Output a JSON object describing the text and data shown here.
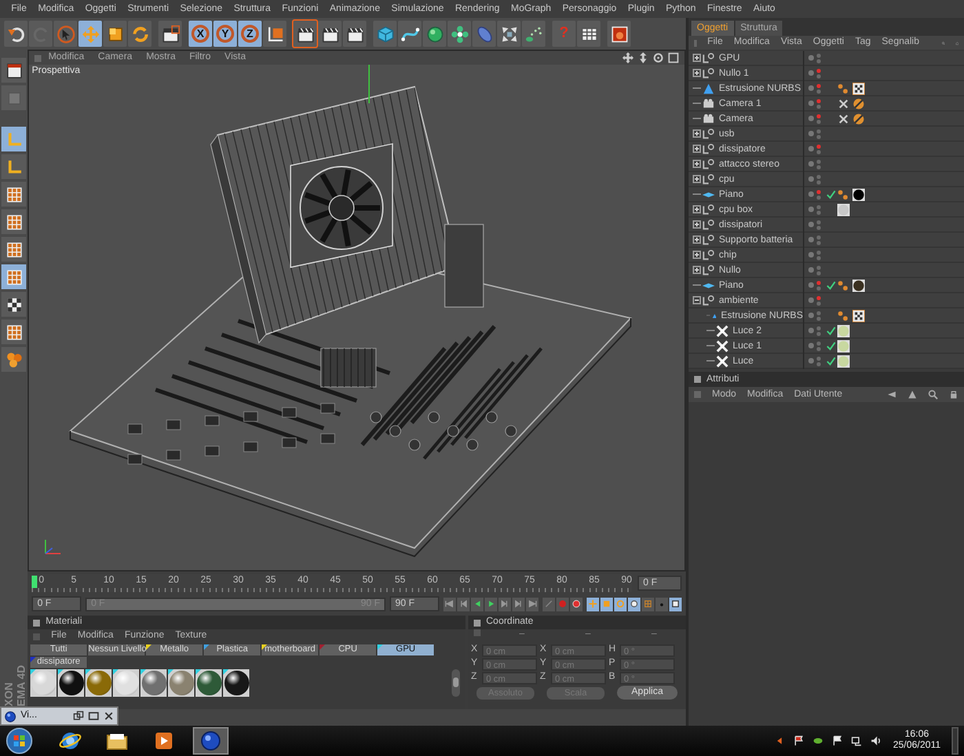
{
  "menu": [
    "File",
    "Modifica",
    "Oggetti",
    "Strumenti",
    "Selezione",
    "Struttura",
    "Funzioni",
    "Animazione",
    "Simulazione",
    "Rendering",
    "MoGraph",
    "Personaggio",
    "Plugin",
    "Python",
    "Finestre",
    "Aiuto"
  ],
  "toolbar": [
    {
      "kind": "undo",
      "selected": false,
      "disabled": false
    },
    {
      "kind": "redo",
      "selected": false,
      "disabled": true
    },
    {
      "kind": "select",
      "selected": false,
      "disabled": false
    },
    {
      "kind": "move",
      "selected": true,
      "disabled": false
    },
    {
      "kind": "scale",
      "selected": false,
      "disabled": false
    },
    {
      "kind": "rotate",
      "selected": false,
      "disabled": false
    },
    {
      "kind": "sep"
    },
    {
      "kind": "recent",
      "selected": false,
      "disabled": false
    },
    {
      "kind": "sep"
    },
    {
      "kind": "axis",
      "label": "X",
      "selected": true,
      "disabled": false
    },
    {
      "kind": "axis",
      "label": "Y",
      "selected": true,
      "disabled": false
    },
    {
      "kind": "axis",
      "label": "Z",
      "selected": true,
      "disabled": false
    },
    {
      "kind": "coord",
      "selected": false,
      "disabled": false
    },
    {
      "kind": "sep"
    },
    {
      "kind": "render-view",
      "selected": false,
      "disabled": false
    },
    {
      "kind": "render-picture",
      "selected": false,
      "disabled": false
    },
    {
      "kind": "render-settings",
      "selected": false,
      "disabled": false
    },
    {
      "kind": "sep"
    },
    {
      "kind": "cube",
      "selected": false,
      "disabled": false
    },
    {
      "kind": "spline",
      "selected": false,
      "disabled": false
    },
    {
      "kind": "nurbs",
      "selected": false,
      "disabled": false
    },
    {
      "kind": "array",
      "selected": false,
      "disabled": false
    },
    {
      "kind": "deformer",
      "selected": false,
      "disabled": false
    },
    {
      "kind": "scene",
      "selected": false,
      "disabled": false
    },
    {
      "kind": "particles",
      "selected": false,
      "disabled": false
    },
    {
      "kind": "sep"
    },
    {
      "kind": "help",
      "label": "?",
      "selected": false,
      "disabled": false
    },
    {
      "kind": "layers",
      "selected": false,
      "disabled": false
    },
    {
      "kind": "sep"
    },
    {
      "kind": "cinema",
      "selected": false,
      "disabled": false
    }
  ],
  "left_tools": [
    {
      "kind": "layout",
      "selected": false
    },
    {
      "kind": "editable",
      "selected": false
    },
    {
      "kind": "corner",
      "selected": true
    },
    {
      "kind": "corner",
      "selected": false
    },
    {
      "kind": "grid",
      "selected": false
    },
    {
      "kind": "grid",
      "selected": false
    },
    {
      "kind": "grid",
      "selected": false
    },
    {
      "kind": "grid",
      "selected": true
    },
    {
      "kind": "checker",
      "selected": false
    },
    {
      "kind": "grid",
      "selected": false
    },
    {
      "kind": "spheres",
      "selected": false
    }
  ],
  "logo_lines": [
    "XON",
    "EMA 4D"
  ],
  "viewport": {
    "menu": [
      "Modifica",
      "Camera",
      "Mostra",
      "Filtro",
      "Vista"
    ],
    "label": "Prospettiva"
  },
  "timeline": {
    "ruler_labels": [
      "0",
      "5",
      "10",
      "15",
      "20",
      "25",
      "30",
      "35",
      "40",
      "45",
      "50",
      "55",
      "60",
      "65",
      "70",
      "75",
      "80",
      "85",
      "90"
    ],
    "level": 0,
    "range_slider": {
      "level": 1
    },
    "current_frame": "0 F",
    "start_frame": "0 F",
    "range_start": "0 F",
    "range_end": "90 F",
    "end_frame": "90 F",
    "transport": [
      {
        "kind": "first"
      },
      {
        "kind": "prev-key"
      },
      {
        "kind": "prev"
      },
      {
        "kind": "play"
      },
      {
        "kind": "next"
      },
      {
        "kind": "next-key"
      },
      {
        "kind": "last"
      }
    ],
    "record": [
      {
        "kind": "key"
      },
      {
        "kind": "record"
      },
      {
        "kind": "autokey"
      }
    ],
    "key_toggles": [
      {
        "kind": "move",
        "selected": true
      },
      {
        "kind": "scale",
        "selected": true
      },
      {
        "kind": "rotate",
        "selected": true
      },
      {
        "kind": "param",
        "selected": true
      },
      {
        "kind": "grid",
        "selected": false
      },
      {
        "kind": "point",
        "selected": false
      },
      {
        "kind": "pla",
        "selected": true
      }
    ]
  },
  "materials": {
    "title": "Materiali",
    "menu": [
      "File",
      "Modifica",
      "Funzione",
      "Texture"
    ],
    "layers": [
      {
        "label": "Tutti",
        "selected": false
      },
      {
        "label": "Nessun Livello",
        "selected": false
      },
      {
        "label": "Metallo",
        "selected": false,
        "color": "#e8d020"
      },
      {
        "label": "Plastica",
        "selected": false,
        "color": "#40a0e0"
      },
      {
        "label": "motherboard",
        "selected": false,
        "color": "#e8d020"
      },
      {
        "label": "CPU",
        "selected": false,
        "color": "#a02030"
      },
      {
        "label": "GPU",
        "selected": true,
        "color": "#30d0e0"
      },
      {
        "label": "dissipatore",
        "selected": false,
        "color": "#2030c0"
      }
    ],
    "swatches": [
      {
        "color": "#d8d8d8"
      },
      {
        "color": "#101010"
      },
      {
        "color": "#8a6a08"
      },
      {
        "color": "#e0e0e0"
      },
      {
        "color": "#707070"
      },
      {
        "color": "#8a8270"
      },
      {
        "color": "#2e5a38"
      },
      {
        "color": "#181818"
      }
    ]
  },
  "coordinates": {
    "title": "Coordinate",
    "column_headers": [
      "–",
      "–",
      "–"
    ],
    "position": [
      {
        "axis": "X",
        "value": "0 cm"
      },
      {
        "axis": "Y",
        "value": "0 cm"
      },
      {
        "axis": "Z",
        "value": "0 cm"
      }
    ],
    "size": [
      {
        "axis": "X",
        "value": "0 cm"
      },
      {
        "axis": "Y",
        "value": "0 cm"
      },
      {
        "axis": "Z",
        "value": "0 cm"
      }
    ],
    "rotation": [
      {
        "axis": "H",
        "value": "0 °"
      },
      {
        "axis": "P",
        "value": "0 °"
      },
      {
        "axis": "B",
        "value": "0 °"
      }
    ],
    "mode_dropdown": "Assoluto",
    "size_dropdown": "Scala",
    "apply_button": "Applica"
  },
  "objects_panel": {
    "tabs": [
      {
        "label": "Oggetti",
        "selected": true
      },
      {
        "label": "Struttura",
        "selected": false
      }
    ],
    "menu": [
      "File",
      "Modifica",
      "Vista",
      "Oggetti",
      "Tag",
      "Segnalib"
    ],
    "objects": [
      {
        "name": "GPU",
        "kind": "null",
        "expanded": false,
        "hidden": false,
        "checked": false
      },
      {
        "name": "Nullo 1",
        "kind": "null",
        "expanded": false,
        "hidden": true,
        "checked": false
      },
      {
        "name": "Estrusione NURBS",
        "kind": "nurbs",
        "hidden": true,
        "checked": false,
        "tags": [
          {
            "kind": "phong"
          },
          {
            "kind": "texture"
          }
        ]
      },
      {
        "name": "Camera 1",
        "kind": "camera",
        "hidden": true,
        "checked": false,
        "tags": [
          {
            "kind": "target"
          },
          {
            "kind": "protection"
          }
        ]
      },
      {
        "name": "Camera",
        "kind": "camera",
        "hidden": true,
        "checked": false,
        "tags": [
          {
            "kind": "target"
          },
          {
            "kind": "protection"
          }
        ]
      },
      {
        "name": "usb",
        "kind": "null",
        "expanded": false,
        "hidden": false,
        "checked": false
      },
      {
        "name": "dissipatore",
        "kind": "null",
        "expanded": false,
        "hidden": true,
        "checked": false
      },
      {
        "name": "attacco stereo",
        "kind": "null",
        "expanded": false,
        "hidden": false,
        "checked": false
      },
      {
        "name": "cpu",
        "kind": "null",
        "expanded": false,
        "hidden": false,
        "checked": false
      },
      {
        "name": "Piano",
        "kind": "plane",
        "hidden": true,
        "checked": true,
        "tags": [
          {
            "kind": "phong"
          },
          {
            "kind": "material",
            "color": "#000000"
          }
        ]
      },
      {
        "name": "cpu box",
        "kind": "null",
        "expanded": false,
        "hidden": false,
        "checked": false,
        "tags": [
          {
            "kind": "material",
            "color": "#c8c8c8"
          }
        ]
      },
      {
        "name": "dissipatori",
        "kind": "null",
        "expanded": false,
        "hidden": false,
        "checked": false
      },
      {
        "name": "Supporto batteria",
        "kind": "null",
        "expanded": false,
        "hidden": false,
        "checked": false
      },
      {
        "name": "chip",
        "kind": "null",
        "expanded": false,
        "hidden": false,
        "checked": false
      },
      {
        "name": "Nullo",
        "kind": "null",
        "expanded": false,
        "hidden": false,
        "checked": false
      },
      {
        "name": "Piano",
        "kind": "plane",
        "hidden": true,
        "checked": true,
        "tags": [
          {
            "kind": "phong"
          },
          {
            "kind": "material",
            "color": "#3a3020"
          }
        ]
      },
      {
        "name": "ambiente",
        "kind": "null",
        "expanded": true,
        "hidden": true,
        "checked": false,
        "children": [
          {
            "name": "Estrusione NURBS",
            "kind": "nurbs",
            "hidden": false,
            "checked": false,
            "tags": [
              {
                "kind": "phong"
              },
              {
                "kind": "texture"
              }
            ]
          },
          {
            "name": "Luce 2",
            "kind": "light",
            "hidden": false,
            "checked": true,
            "tags": [
              {
                "kind": "material",
                "color": "#c8d8a0"
              }
            ]
          },
          {
            "name": "Luce 1",
            "kind": "light",
            "hidden": false,
            "checked": true,
            "tags": [
              {
                "kind": "material",
                "color": "#c8d8a0"
              }
            ]
          },
          {
            "name": "Luce",
            "kind": "light",
            "hidden": false,
            "checked": true,
            "tags": [
              {
                "kind": "material",
                "color": "#c8d8a0"
              }
            ]
          }
        ]
      }
    ]
  },
  "attributes_panel": {
    "title": "Attributi",
    "menu": [
      "Modo",
      "Modifica",
      "Dati Utente"
    ]
  },
  "minimized_window": {
    "title": "Vi..."
  },
  "taskbar": {
    "apps": [
      {
        "kind": "ie",
        "selected": false
      },
      {
        "kind": "folder",
        "selected": false
      },
      {
        "kind": "media",
        "selected": false
      },
      {
        "kind": "cinema",
        "selected": true
      }
    ],
    "time": "16:06",
    "date": "25/06/2011"
  }
}
